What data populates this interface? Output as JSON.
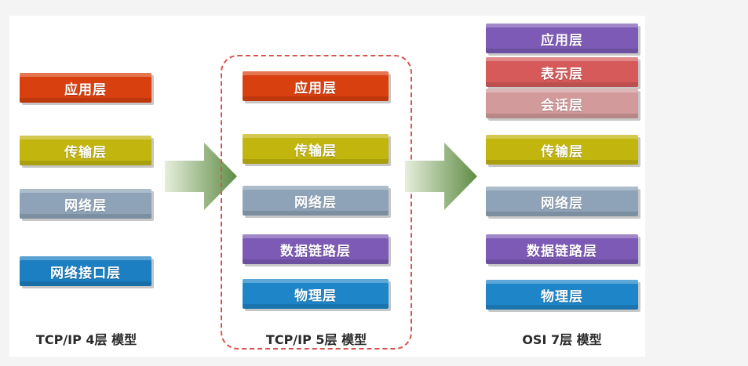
{
  "colors": {
    "application": "#d9400f",
    "transport": "#c2b50e",
    "network": "#8ea3b8",
    "link": "#1b7fc2",
    "datalink": "#7d5ab5",
    "physical": "#1e86c8",
    "presentation": "#d65a5a",
    "session": "#d29a9a",
    "arrow": "#6f9b54"
  },
  "model_4": {
    "caption": "TCP/IP 4层 模型",
    "layers": [
      "应用层",
      "传输层",
      "网络层",
      "网络接口层"
    ]
  },
  "model_5": {
    "caption": "TCP/IP 5层 模型",
    "layers": [
      "应用层",
      "传输层",
      "网络层",
      "数据链路层",
      "物理层"
    ]
  },
  "model_7": {
    "caption": "OSI 7层 模型",
    "layers": [
      "应用层",
      "表示层",
      "会话层",
      "传输层",
      "网络层",
      "数据链路层",
      "物理层"
    ]
  }
}
